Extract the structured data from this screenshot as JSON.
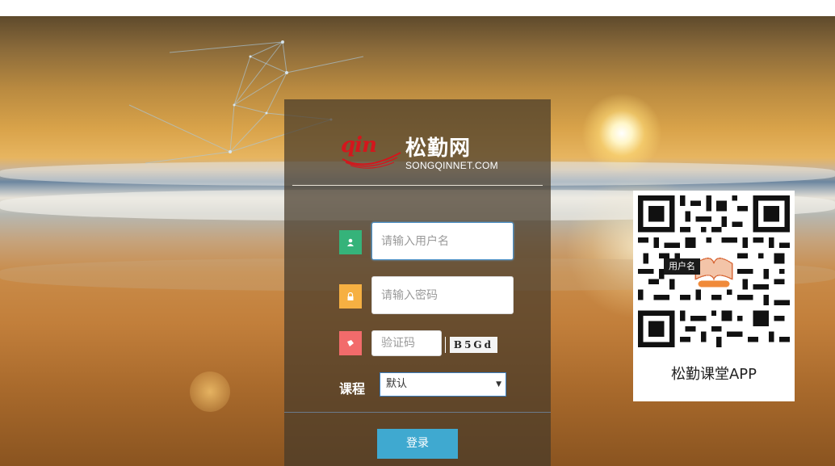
{
  "logo": {
    "script_text": "qin",
    "name": "松勤网",
    "subtitle": "SONGQINNET.COM"
  },
  "login": {
    "username_placeholder": "请输入用户名",
    "password_placeholder": "请输入密码",
    "captcha_placeholder": "验证码",
    "captcha_text": "B5Gd",
    "course_label": "课程",
    "course_selected": "默认",
    "login_button": "登录"
  },
  "icons": {
    "username": "user-icon",
    "password": "lock-icon",
    "captcha": "captcha-icon"
  },
  "qr": {
    "tooltip": "用户名",
    "center_logo_text": "松勤课堂",
    "caption": "松勤课堂APP"
  },
  "colors": {
    "user_icon_bg": "#35b37a",
    "lock_icon_bg": "#f6b042",
    "captcha_icon_bg": "#f26b6b",
    "login_button_bg": "#3fa9d0",
    "logo_red": "#d4161c"
  }
}
